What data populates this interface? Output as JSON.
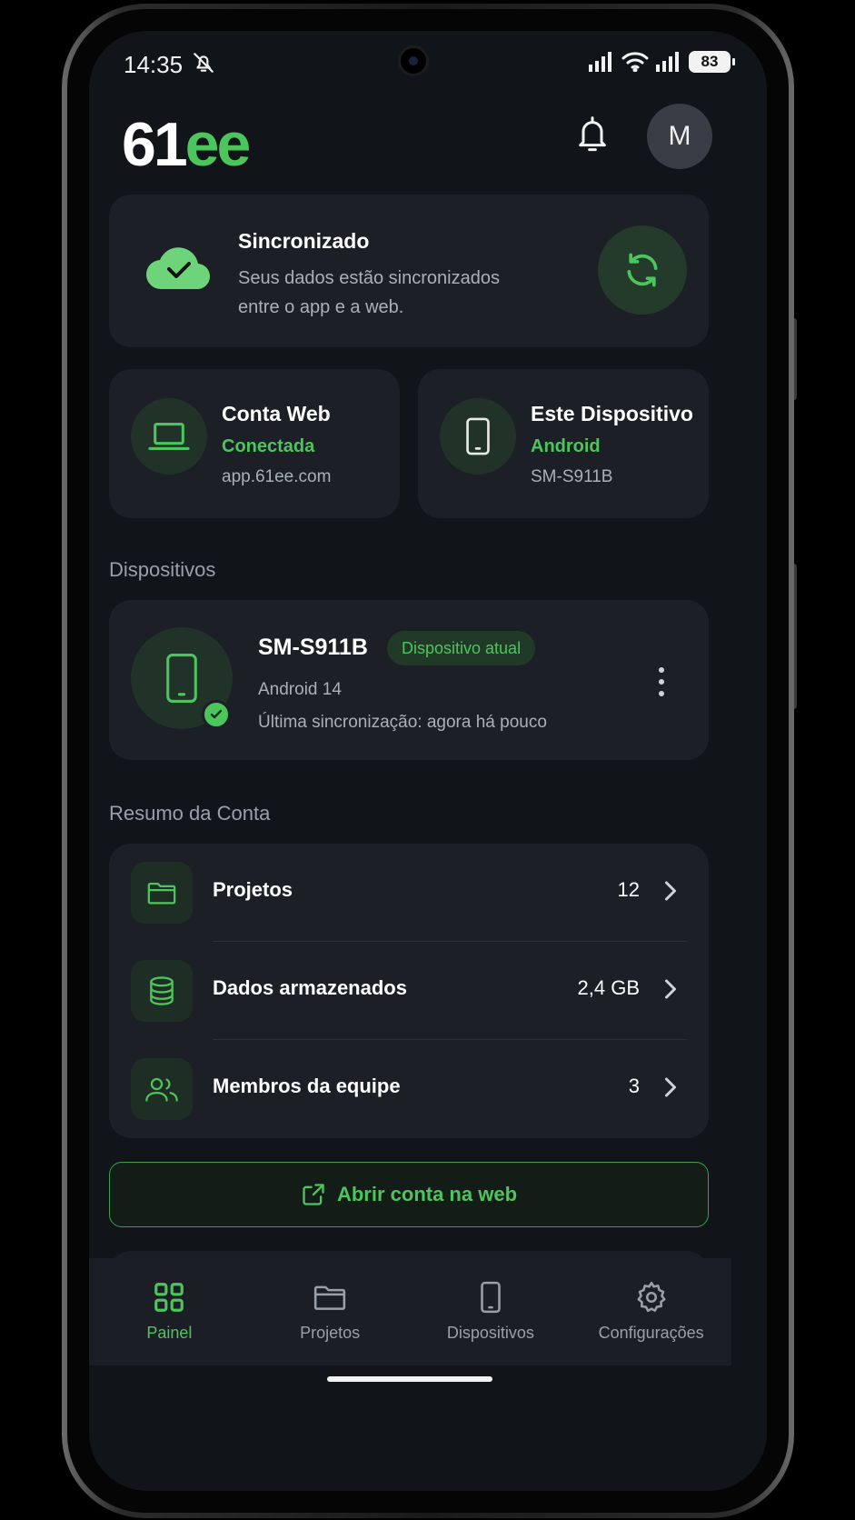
{
  "status_bar": {
    "time": "14:35",
    "battery": "83"
  },
  "header": {
    "logo_white": "61",
    "logo_green": "ee",
    "avatar_initial": "M"
  },
  "sync": {
    "title": "Sincronizado",
    "description": "Seus dados estão sincronizados entre o app e a web."
  },
  "web_account": {
    "title": "Conta Web",
    "status": "Conectada",
    "url": "app.61ee.com"
  },
  "this_device": {
    "title": "Este Dispositivo",
    "platform": "Android",
    "model": "SM-S911B"
  },
  "devices": {
    "section_label": "Dispositivos",
    "item": {
      "name": "SM-S911B",
      "badge": "Dispositivo atual",
      "os": "Android 14",
      "last_sync": "Última sincronização: agora há pouco"
    }
  },
  "summary": {
    "section_label": "Resumo da Conta",
    "rows": [
      {
        "label": "Projetos",
        "value": "12",
        "icon": "folder-icon"
      },
      {
        "label": "Dados armazenados",
        "value": "2,4 GB",
        "icon": "database-icon"
      },
      {
        "label": "Membros da equipe",
        "value": "3",
        "icon": "users-icon"
      }
    ]
  },
  "open_web_button": {
    "label": "Abrir conta na web"
  },
  "tabs": [
    {
      "label": "Painel",
      "active": true
    },
    {
      "label": "Projetos",
      "active": false
    },
    {
      "label": "Dispositivos",
      "active": false
    },
    {
      "label": "Configurações",
      "active": false
    }
  ],
  "colors": {
    "accent": "#4cc65c",
    "background": "#111419",
    "card": "#1c1f26"
  }
}
